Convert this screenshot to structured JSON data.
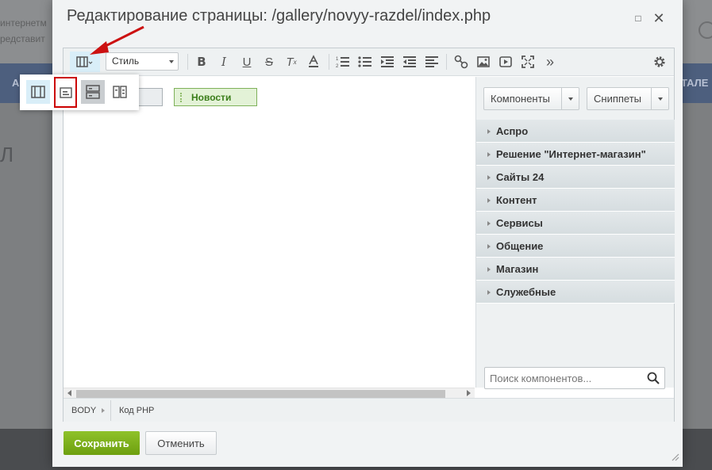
{
  "background": {
    "text_line1": "интернетм",
    "text_line2": "редставит",
    "nav_left": "А",
    "nav_right": "ТАЛЕ",
    "big_text": "Л"
  },
  "dialog": {
    "title": "Редактирование страницы: /gallery/novyy-razdel/index.php",
    "minimize_label": "□",
    "close_label": "✕"
  },
  "toolbar": {
    "style_select": "Стиль",
    "icons": [
      "view-mode-icon",
      "bold-icon",
      "italic-icon",
      "underline-icon",
      "strikethrough-icon",
      "remove-format-icon",
      "text-color-icon",
      "ordered-list-icon",
      "unordered-list-icon",
      "indent-icon",
      "outdent-icon",
      "align-left-icon",
      "link-icon",
      "image-icon",
      "video-icon",
      "fullscreen-icon",
      "more-icon",
      "settings-icon"
    ]
  },
  "view_popup": {
    "options": [
      "visual-and-code",
      "visual-only",
      "code-top",
      "split"
    ]
  },
  "content": {
    "news_component": "Новости"
  },
  "right_panel": {
    "components_button": "Компоненты",
    "snippets_button": "Сниппеты",
    "groups": [
      "Аспро",
      "Решение \"Интернет-магазин\"",
      "Сайты 24",
      "Контент",
      "Сервисы",
      "Общение",
      "Магазин",
      "Служебные"
    ],
    "search_placeholder": "Поиск компонентов..."
  },
  "statusbar": {
    "body": "BODY",
    "php_code": "Код PHP"
  },
  "footer": {
    "save": "Сохранить",
    "cancel": "Отменить"
  },
  "colors": {
    "accent_green": "#7bb11a",
    "annotation_red": "#cc1111"
  }
}
